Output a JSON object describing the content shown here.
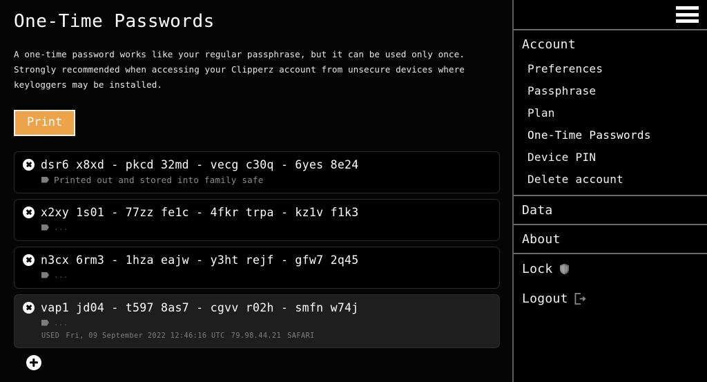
{
  "main": {
    "title": "One-Time Passwords",
    "description": "A one-time password works like your regular passphrase, but it can be used only once. Strongly recommended when accessing your Clipperz account from unsecure devices where keyloggers may be installed.",
    "print_button": "Print",
    "add_button_icon": "plus-circle-icon",
    "otp_rows": [
      {
        "password": "dsr6 x8xd - pkcd 32md - vecg c30q - 6yes 8e24",
        "note": "Printed out and stored into family safe",
        "note_placeholder": "",
        "status": "active",
        "used_label": "",
        "used_date": "",
        "used_ip": "",
        "used_browser": ""
      },
      {
        "password": "x2xy 1s01 - 77zz fe1c - 4fkr trpa - kz1v f1k3",
        "note": "",
        "note_placeholder": "...",
        "status": "active",
        "used_label": "",
        "used_date": "",
        "used_ip": "",
        "used_browser": ""
      },
      {
        "password": "n3cx 6rm3 - 1hza eajw - y3ht rejf - gfw7 2q45",
        "note": "",
        "note_placeholder": "...",
        "status": "active",
        "used_label": "",
        "used_date": "",
        "used_ip": "",
        "used_browser": ""
      },
      {
        "password": "vap1 jd04 - t597 8as7 - cgvv r02h - smfn w74j",
        "note": "",
        "note_placeholder": "...",
        "status": "used",
        "used_label": "USED",
        "used_date": "Fri, 09 September 2022 12:46:16 UTC",
        "used_ip": "79.98.44.21",
        "used_browser": "SAFARI"
      }
    ]
  },
  "sidebar": {
    "menu_icon": "hamburger-menu-icon",
    "account": {
      "header": "Account",
      "items": [
        {
          "label": "Preferences",
          "active": false
        },
        {
          "label": "Passphrase",
          "active": false
        },
        {
          "label": "Plan",
          "active": false
        },
        {
          "label": "One-Time Passwords",
          "active": true
        },
        {
          "label": "Device PIN",
          "active": false
        },
        {
          "label": "Delete account",
          "active": false
        }
      ]
    },
    "data_header": "Data",
    "about_header": "About",
    "lock_label": "Lock",
    "lock_icon": "shield-icon",
    "logout_label": "Logout",
    "logout_icon": "logout-arrow-icon"
  },
  "colors": {
    "accent_orange": "#eda34a",
    "background": "#000000",
    "used_row_background": "#1e1e1e",
    "text_primary": "#ffffff",
    "text_muted": "#8d8d8d",
    "divider": "#6a6a6a"
  }
}
